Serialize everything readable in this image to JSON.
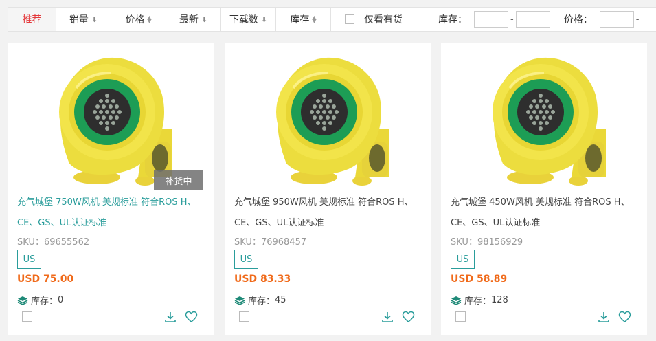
{
  "sort_bar": {
    "items": [
      {
        "label": "推荐",
        "arrow": ""
      },
      {
        "label": "销量",
        "arrow": "⬇"
      },
      {
        "label": "价格",
        "arrow": "⇕"
      },
      {
        "label": "最新",
        "arrow": "⬇"
      },
      {
        "label": "下载数",
        "arrow": "⬇"
      },
      {
        "label": "库存",
        "arrow": "⇕"
      }
    ],
    "only_in_stock_label": "仅看有货",
    "stock_range_label": "库存：",
    "price_range_label": "价格：",
    "range_dash": "-"
  },
  "colors": {
    "accent": "#2a9d9b",
    "price": "#f06a1a",
    "active_sort": "#e4393c"
  },
  "products": [
    {
      "title": "充气城堡 750W风机 美规标准 符合ROS H、CE、GS、UL认证标准",
      "sku_label": "SKU：",
      "sku": "69655562",
      "tag": "US",
      "price": "USD 75.00",
      "stock_label": "库存：",
      "stock": "0",
      "badge": "补货中"
    },
    {
      "title": "充气城堡 950W风机 美规标准 符合ROS H、CE、GS、UL认证标准",
      "sku_label": "SKU：",
      "sku": "76968457",
      "tag": "US",
      "price": "USD 83.33",
      "stock_label": "库存：",
      "stock": "45",
      "badge": ""
    },
    {
      "title": "充气城堡 450W风机 美规标准 符合ROS H、CE、GS、UL认证标准",
      "sku_label": "SKU：",
      "sku": "98156929",
      "tag": "US",
      "price": "USD 58.89",
      "stock_label": "库存：",
      "stock": "128",
      "badge": ""
    }
  ],
  "icons": {
    "stock": "layers-icon",
    "download": "download-icon",
    "favorite": "heart-icon"
  }
}
